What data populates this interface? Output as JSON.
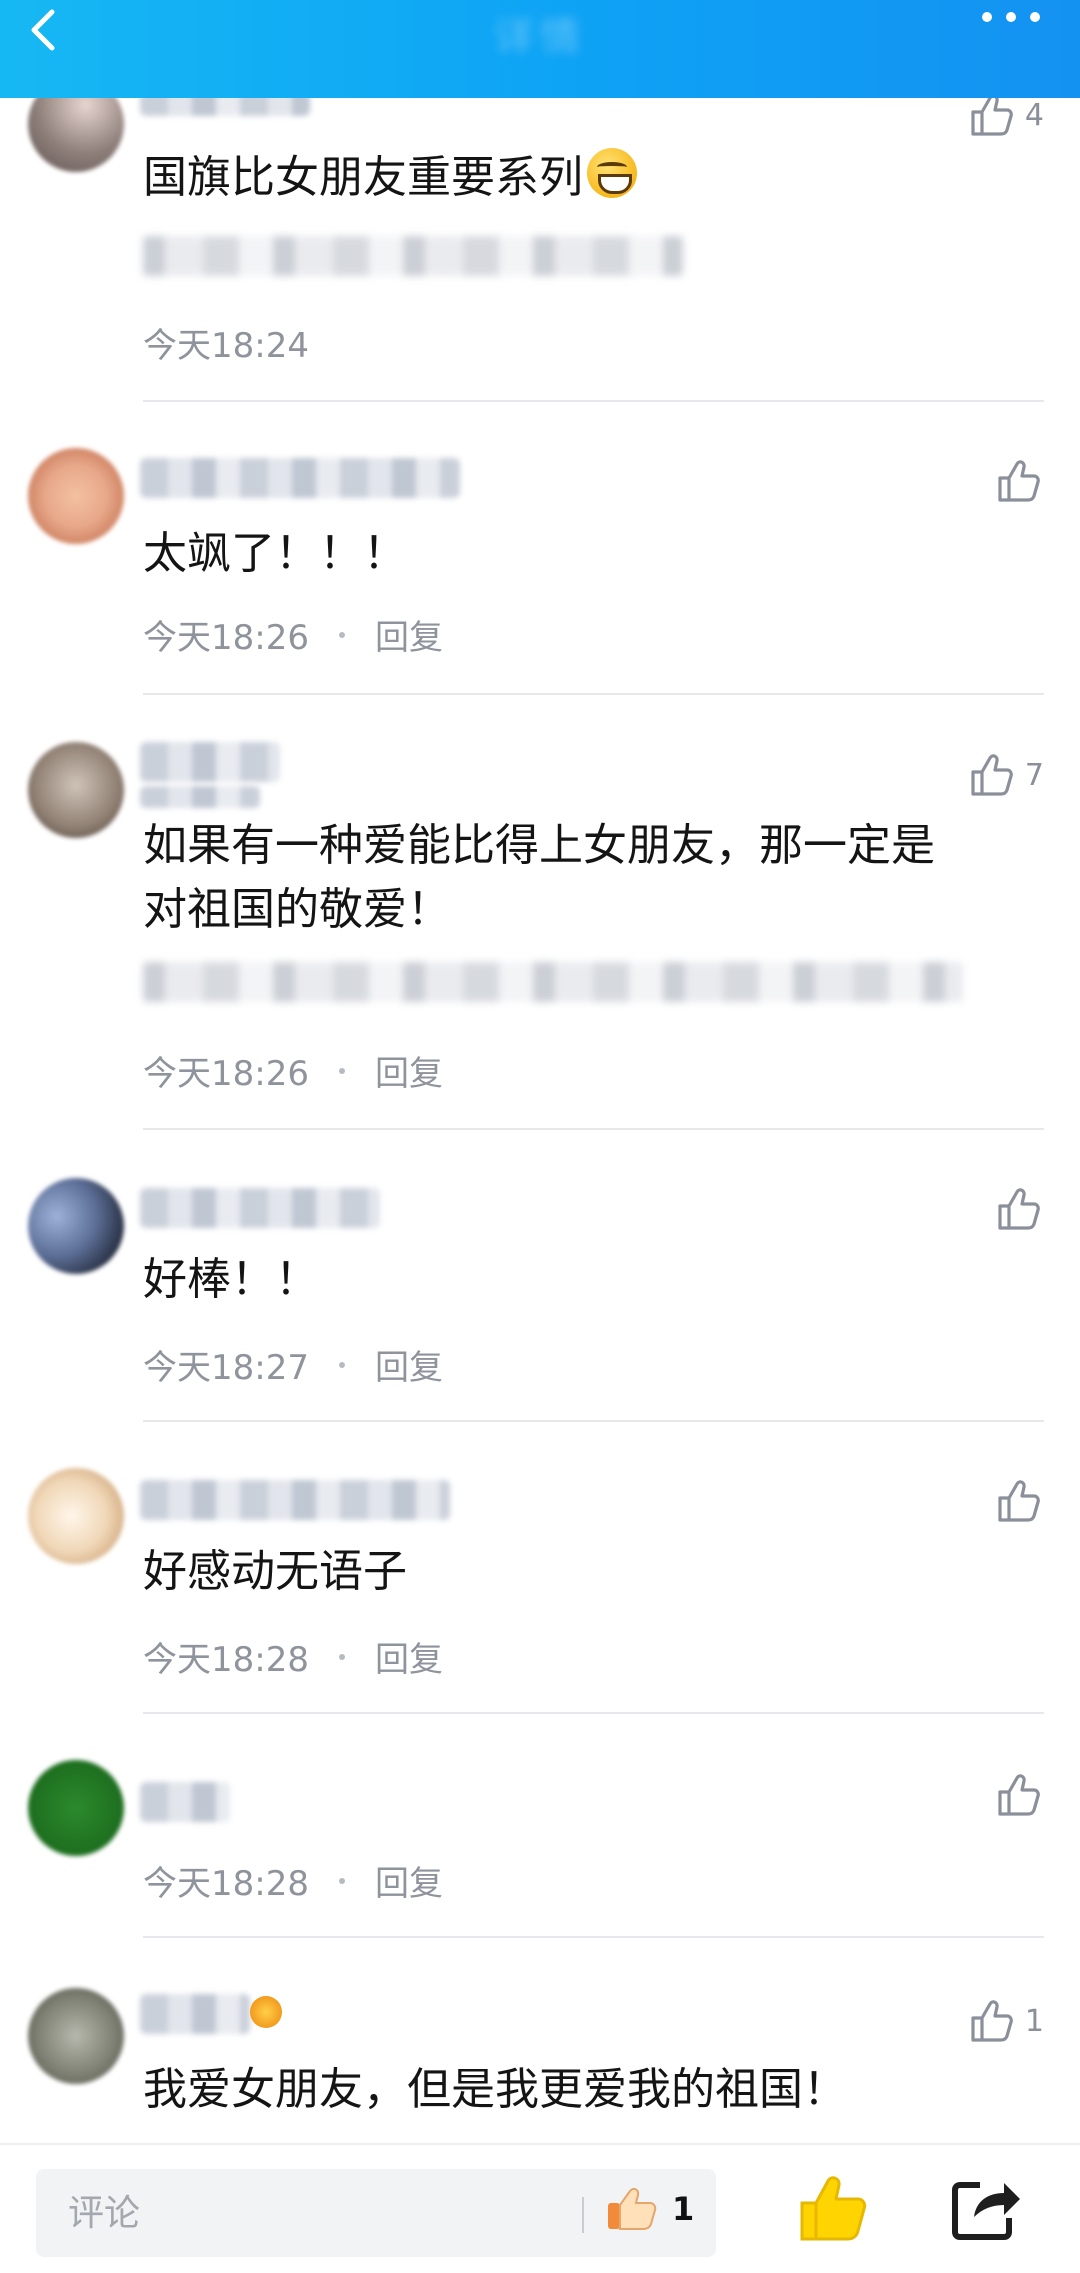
{
  "header": {
    "title": "详情"
  },
  "comments": [
    {
      "text": "国旗比女朋友重要系列",
      "time": "今天18:24",
      "reply": "",
      "likes": "4"
    },
    {
      "text": "太飒了！！！",
      "time": "今天18:26",
      "reply": "回复",
      "likes": ""
    },
    {
      "text_line1": "如果有一种爱能比得上女朋友，那一定是",
      "text_line2": "对祖国的敬爱！",
      "time": "今天18:26",
      "reply": "回复",
      "likes": "7"
    },
    {
      "text": "好棒！！",
      "time": "今天18:27",
      "reply": "回复",
      "likes": ""
    },
    {
      "text": "好感动无语子",
      "time": "今天18:28",
      "reply": "回复",
      "likes": ""
    },
    {
      "time": "今天18:28",
      "reply": "回复",
      "likes": ""
    },
    {
      "text": "我爱女朋友，但是我更爱我的祖国！",
      "likes": "1"
    }
  ],
  "bottom": {
    "placeholder": "评论",
    "like_count": "1"
  },
  "icons": {
    "back": "chevron-left-icon",
    "more": "more-dots-icon",
    "like": "thumbs-up-icon",
    "share": "share-icon"
  },
  "colors": {
    "header": "#0ea2f5",
    "like_yellow": "#ffd400"
  }
}
